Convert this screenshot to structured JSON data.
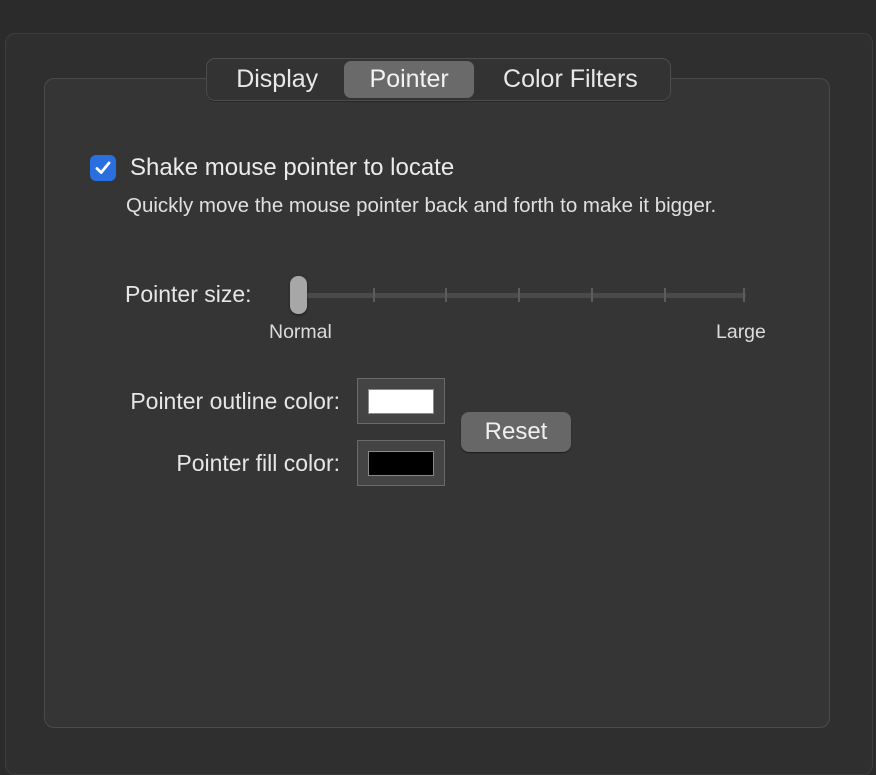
{
  "tabs": [
    {
      "label": "Display",
      "selected": false
    },
    {
      "label": "Pointer",
      "selected": true
    },
    {
      "label": "Color Filters",
      "selected": false
    }
  ],
  "shake": {
    "label": "Shake mouse pointer to locate",
    "checked": true,
    "description": "Quickly move the mouse pointer back and forth to make it bigger."
  },
  "pointer_size": {
    "label": "Pointer size:",
    "min_label": "Normal",
    "max_label": "Large",
    "value_fraction": 0.0,
    "tick_count": 7
  },
  "colors": {
    "outline_label": "Pointer outline color:",
    "outline_color": "#ffffff",
    "fill_label": "Pointer fill color:",
    "fill_color": "#000000",
    "reset_label": "Reset"
  },
  "theme": {
    "accent": "#2a6fe0",
    "selected_tab": "#6a6a6a"
  },
  "icons": {
    "checkbox": "checkmark-icon"
  }
}
